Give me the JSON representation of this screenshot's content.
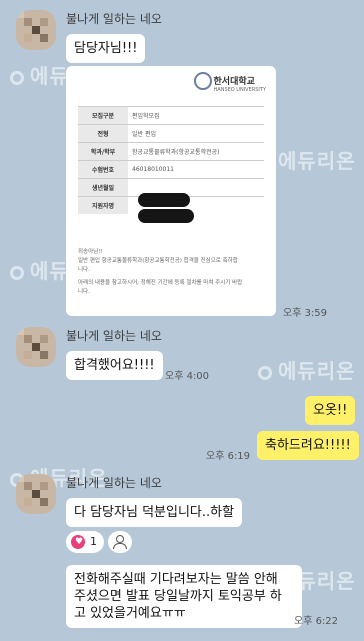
{
  "watermark": "에듀리온",
  "messages": [
    {
      "sender": "불나게 일하는 네오",
      "text": "담당자님!!!"
    },
    {
      "image_time": "오후 3:59"
    },
    {
      "sender": "불나게 일하는 네오",
      "text": "합격했어요!!!!",
      "time": "오후 4:00"
    },
    {
      "me": true,
      "text": "오옷!!"
    },
    {
      "me": true,
      "text": "축하드려요!!!!!",
      "time": "오후 6:19"
    },
    {
      "sender": "불나게 일하는 네오",
      "text": "다 담당자님 덕분입니다..하할",
      "reaction_count": "1"
    },
    {
      "text_lines": [
        "전화해주실때 기다려보자는 말씀 안해",
        "주셨으면 발표 당일날까지 토익공부 하",
        "고 있었을거예요ㅠㅠ"
      ],
      "time": "오후 6:22"
    }
  ],
  "doc": {
    "logo": "한서대학교",
    "logo_sub": "HANSEO UNIVERSITY",
    "rows": [
      {
        "k": "모집구분",
        "v": "편입학모집"
      },
      {
        "k": "전형",
        "v": "일반 편입"
      },
      {
        "k": "학과/학부",
        "v": "항공교통물류학과(항공교통학전공)"
      },
      {
        "k": "수험번호",
        "v": "46018010011"
      },
      {
        "k": "생년월일",
        "v": ""
      },
      {
        "k": "지원자명",
        "v": ""
      }
    ],
    "note_1": "죄송아님!!",
    "note_2": "일반 편입 항공교통물류학과(항공교통학전공) 합격을 진심으로 축하합",
    "note_3": "니다.",
    "note_4": "아래의 내용을 참고하시어, 정해진 기간에 등록 절차를 마쳐 주시기 바랍",
    "note_5": "니다."
  }
}
